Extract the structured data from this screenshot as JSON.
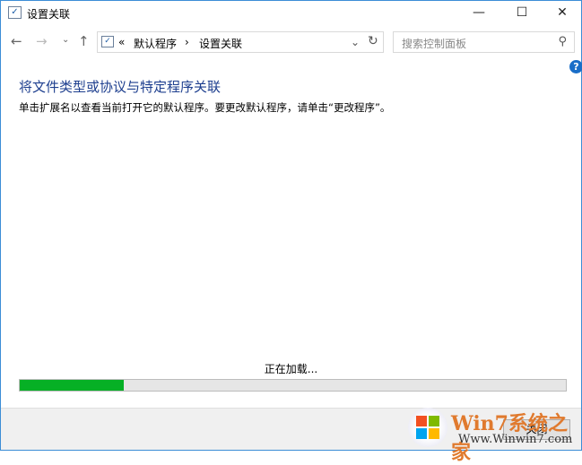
{
  "window": {
    "title": "设置关联",
    "minimize": "—",
    "maximize": "☐",
    "close": "✕"
  },
  "nav": {
    "back": "←",
    "forward": "→",
    "recent": "⌄",
    "up": "↑",
    "breadcrumb_prefix": "«",
    "crumbs": [
      "默认程序",
      "设置关联"
    ],
    "separator": "›",
    "dropdown": "⌄",
    "refresh": "↻"
  },
  "search": {
    "placeholder": "搜索控制面板",
    "icon": "⚲"
  },
  "help": "?",
  "main": {
    "heading": "将文件类型或协议与特定程序关联",
    "description": "单击扩展名以查看当前打开它的默认程序。要更改默认程序，请单击“更改程序”。",
    "loading": "正在加载...",
    "progress": 0.19
  },
  "footer": {
    "close_label": "关闭"
  },
  "watermark": {
    "brand": "Win7系统之家",
    "url": "Www.Winwin7.com"
  },
  "colors": {
    "progress": "#06b025",
    "heading": "#1e3f8f"
  }
}
